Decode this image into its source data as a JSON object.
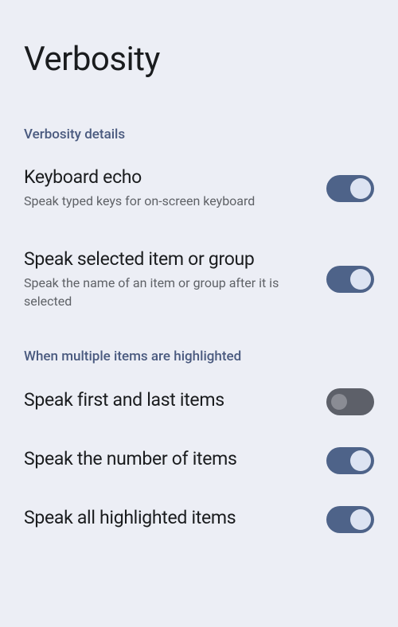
{
  "page": {
    "title": "Verbosity"
  },
  "sections": {
    "details": {
      "header": "Verbosity details",
      "items": {
        "keyboard_echo": {
          "title": "Keyboard echo",
          "desc": "Speak typed keys for on-screen keyboard",
          "enabled": true
        },
        "speak_selected": {
          "title": "Speak selected item or group",
          "desc": "Speak the name of an item or group after it is selected",
          "enabled": true
        }
      }
    },
    "multiple": {
      "header": "When multiple items are highlighted",
      "items": {
        "first_last": {
          "title": "Speak first and last items",
          "enabled": false
        },
        "number": {
          "title": "Speak the number of items",
          "enabled": true
        },
        "all": {
          "title": "Speak all highlighted items",
          "enabled": true
        }
      }
    }
  }
}
